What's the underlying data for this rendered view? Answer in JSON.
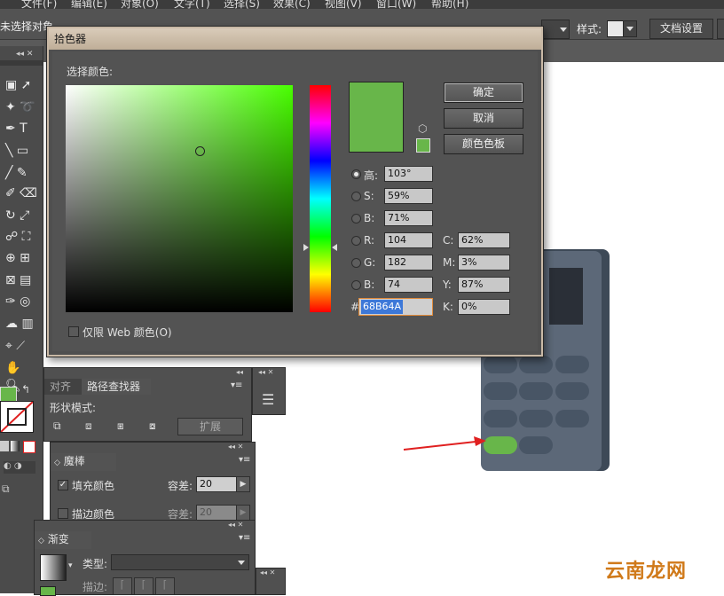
{
  "menubar": {
    "items": [
      "文件(F)",
      "编辑(E)",
      "对象(O)",
      "文字(T)",
      "选择(S)",
      "效果(C)",
      "视图(V)",
      "窗口(W)",
      "帮助(H)"
    ]
  },
  "control_bar": {
    "selection_label": "未选择对象",
    "style_label": "样式:",
    "doc_setup_label": "文档设置"
  },
  "tools": {
    "icons": [
      "direct-selection-icon",
      "magic-wand-icon",
      "lasso-icon",
      "pen-icon",
      "type-icon",
      "line-icon",
      "rectangle-icon",
      "paintbrush-icon",
      "pencil-icon",
      "rotate-icon",
      "scale-icon",
      "warp-icon",
      "free-transform-icon",
      "shape-builder-icon",
      "perspective-icon",
      "mesh-icon",
      "gradient-icon",
      "eyedropper-icon",
      "blend-icon",
      "symbol-sprayer-icon",
      "column-graph-icon",
      "artboard-icon",
      "slice-icon",
      "hand-icon",
      "zoom-icon"
    ]
  },
  "color_picker": {
    "title": "拾色器",
    "select_color_label": "选择颜色:",
    "hue_marker_percent": 71.4,
    "sb_marker": {
      "s": 59,
      "b": 71
    },
    "new_color": "#68B64A",
    "ok_label": "确定",
    "cancel_label": "取消",
    "swatches_label": "颜色色板",
    "hsb": {
      "h_label": "高:",
      "h_value": "103°",
      "s_label": "S:",
      "s_value": "59%",
      "b_label": "B:",
      "b_value": "71%"
    },
    "rgb": {
      "r_label": "R:",
      "r_value": "104",
      "g_label": "G:",
      "g_value": "182",
      "b_label": "B:",
      "b_value": "74"
    },
    "cmyk": {
      "c_label": "C:",
      "c_value": "62%",
      "m_label": "M:",
      "m_value": "3%",
      "y_label": "Y:",
      "y_value": "87%",
      "k_label": "K:",
      "k_value": "0%"
    },
    "hex_label": "#",
    "hex_value": "68B64A",
    "web_only_label": "仅限 Web 颜色(O)"
  },
  "pathfinder_panel": {
    "tab_align": "对齐",
    "tab_pathfinder": "路径查找器",
    "shape_modes_label": "形状模式:",
    "expand_label": "扩展"
  },
  "magic_wand_panel": {
    "title": "魔棒",
    "fill_color_label": "填充颜色",
    "fill_tolerance_label": "容差:",
    "fill_tolerance_value": "20",
    "stroke_color_label": "描边颜色",
    "stroke_tolerance_label": "容差:",
    "stroke_tolerance_value": "20"
  },
  "gradient_panel": {
    "title": "渐变",
    "type_label": "类型:",
    "stroke_label": "描边:"
  },
  "colors": {
    "accent_green": "#68B64A",
    "phone_body": "#5c6878",
    "phone_keys": "#485565",
    "arrow_red": "#e02020"
  },
  "watermark": "云南龙网"
}
